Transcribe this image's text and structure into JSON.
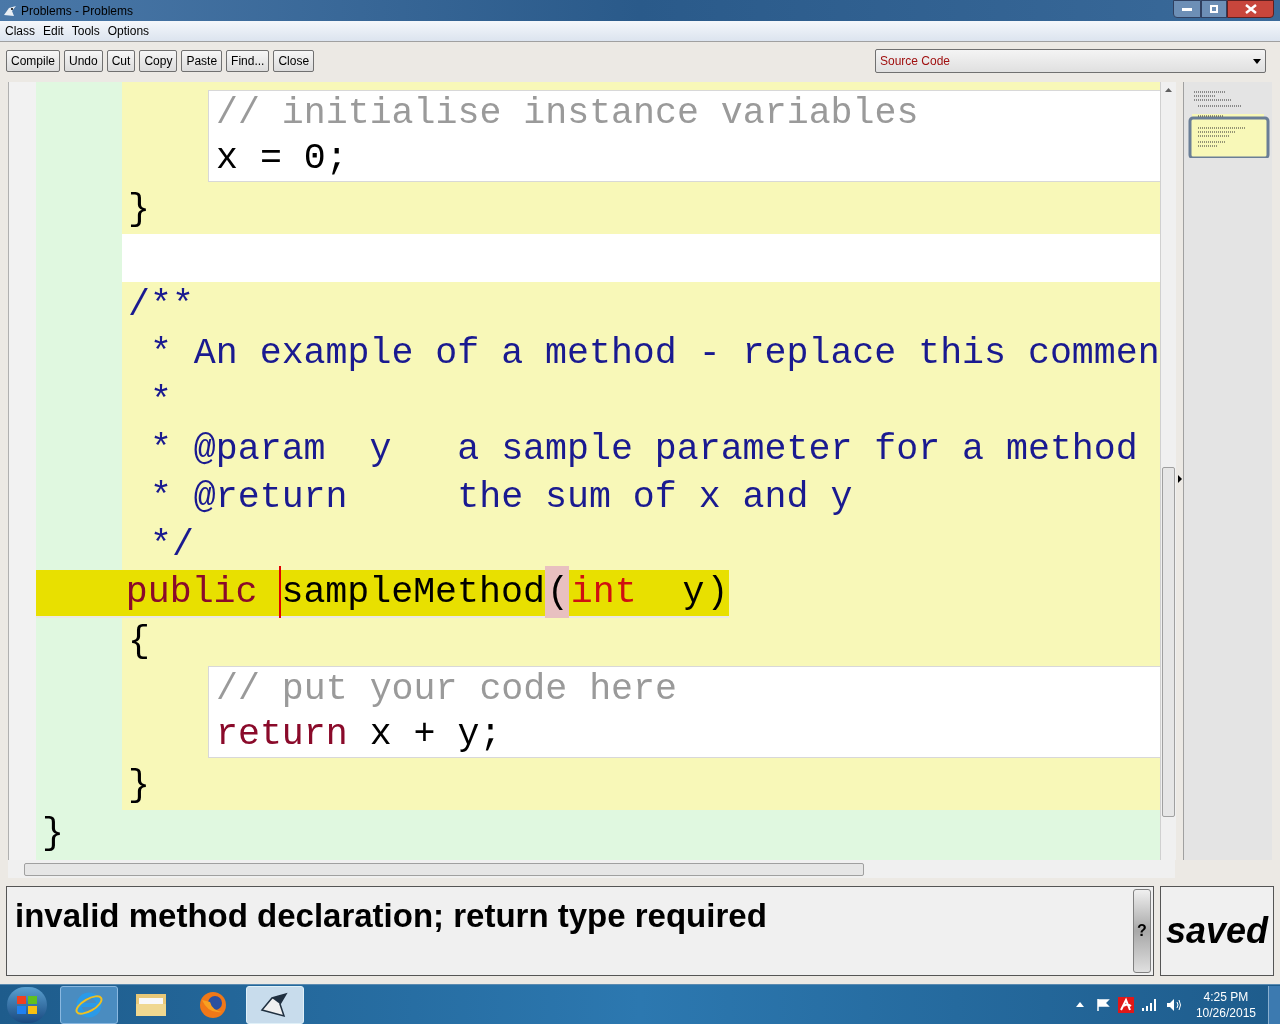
{
  "window": {
    "title": "Problems - Problems"
  },
  "menu": [
    "Class",
    "Edit",
    "Tools",
    "Options"
  ],
  "toolbar": [
    "Compile",
    "Undo",
    "Cut",
    "Copy",
    "Paste",
    "Find...",
    "Close"
  ],
  "view_selector": {
    "value": "Source Code"
  },
  "editor": {
    "lines": [
      {
        "kind": "body",
        "highlighted": false,
        "tokens": [
          {
            "kind": "comment",
            "text": "// initialise instance variables"
          }
        ]
      },
      {
        "kind": "body",
        "highlighted": false,
        "tokens": [
          {
            "kind": "plain",
            "text": "x = 0;"
          }
        ]
      },
      {
        "kind": "method",
        "highlighted": false,
        "tokens": [
          {
            "kind": "plain",
            "text": "}"
          }
        ]
      },
      {
        "kind": "gap",
        "highlighted": false
      },
      {
        "kind": "method",
        "highlighted": false,
        "tokens": [
          {
            "kind": "javadoc",
            "text": "/**"
          }
        ]
      },
      {
        "kind": "method",
        "highlighted": false,
        "tokens": [
          {
            "kind": "javadoc",
            "text": " * An example of a method - replace this commen"
          }
        ]
      },
      {
        "kind": "method",
        "highlighted": false,
        "tokens": [
          {
            "kind": "javadoc",
            "text": " *"
          }
        ]
      },
      {
        "kind": "method",
        "highlighted": false,
        "tokens": [
          {
            "kind": "javadoc",
            "text": " * @param  y   a sample parameter for a method"
          }
        ]
      },
      {
        "kind": "method",
        "highlighted": false,
        "tokens": [
          {
            "kind": "javadoc",
            "text": " * @return     the sum of x and y"
          }
        ]
      },
      {
        "kind": "method",
        "highlighted": false,
        "tokens": [
          {
            "kind": "javadoc",
            "text": " */"
          }
        ]
      },
      {
        "kind": "class",
        "highlighted": true,
        "tokens": [
          {
            "kind": "keyword",
            "text": "    public ",
            "caret": false
          },
          {
            "kind": "plain",
            "text": "sampleMethod",
            "caret": true
          },
          {
            "kind": "bracket",
            "text": "(",
            "caret": false,
            "matched": true
          },
          {
            "kind": "type",
            "text": "int",
            "caret": false
          },
          {
            "kind": "plain",
            "text": "  y",
            "caret": false
          },
          {
            "kind": "bracket",
            "text": ")",
            "caret": false,
            "matched": false
          }
        ]
      },
      {
        "kind": "method",
        "highlighted": false,
        "tokens": [
          {
            "kind": "plain",
            "text": "{"
          }
        ]
      },
      {
        "kind": "body",
        "highlighted": false,
        "tokens": [
          {
            "kind": "comment",
            "text": "// put your code here"
          }
        ]
      },
      {
        "kind": "body",
        "highlighted": false,
        "tokens": [
          {
            "kind": "keyword",
            "text": "return"
          },
          {
            "kind": "plain",
            "text": " x + y;"
          }
        ]
      },
      {
        "kind": "method",
        "highlighted": false,
        "tokens": [
          {
            "kind": "plain",
            "text": "}"
          }
        ]
      },
      {
        "kind": "class",
        "highlighted": false,
        "tokens": [
          {
            "kind": "plain",
            "text": "}"
          }
        ]
      }
    ]
  },
  "error_message": "invalid method declaration; return type required",
  "help_button": "?",
  "save_status": "saved",
  "clock": {
    "time": "4:25 PM",
    "date": "10/26/2015"
  }
}
